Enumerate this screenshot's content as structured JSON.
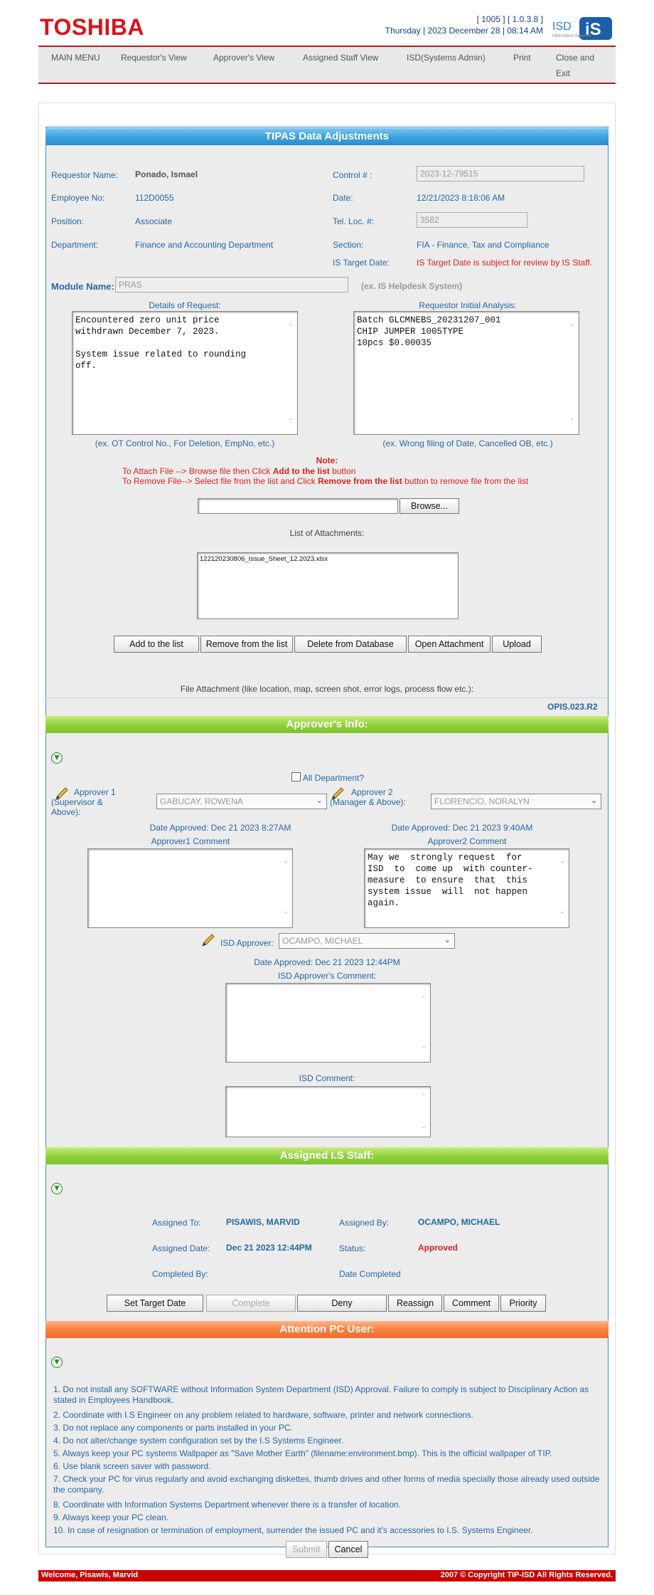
{
  "header": {
    "logo": "TOSHIBA",
    "version": "[ 1005 ] [ 1.0.3.8 ]",
    "datetime": "Thursday | 2023 December 28 | 08:14 AM",
    "isd_logo": "ISD"
  },
  "nav": [
    "MAIN MENU",
    "Requestor's View",
    "Approver's View",
    "Assigned Staff View",
    "ISD(Systems Admin)",
    "Print",
    "Close and",
    "Exit"
  ],
  "form": {
    "title": "TIPAS Data Adjustments",
    "requestor_name_label": "Requestor Name:",
    "requestor_name": "Ponado, Ismael",
    "control_label": "Control # :",
    "control_value": "2023-12-79515",
    "employee_no_label": "Employee No:",
    "employee_no": "112D0055",
    "date_label": "Date:",
    "date_value": "12/21/2023 8:18:06 AM",
    "position_label": "Position:",
    "position": "Associate",
    "telloc_label": "Tel. Loc. #:",
    "telloc_value": "3582",
    "department_label": "Department:",
    "department": "Finance and Accounting Department",
    "section_label": "Section:",
    "section": "FIA - Finance, Tax and Compliance",
    "target_date_label": "IS Target Date:",
    "target_date_note": "IS Target Date is subject for review by IS Staff.",
    "module_label": "Module Name:",
    "module_value": "PRAS",
    "module_hint": "(ex. IS Helpdesk System)",
    "details_label": "Details of Request:",
    "details_text": "Encountered zero unit price\nwithdrawn December 7, 2023.\n\nSystem issue related to rounding\noff.",
    "details_hint": "(ex. OT Control No., For Deletion, EmpNo, etc.)",
    "analysis_label": "Requestor Initial Analysis:",
    "analysis_text": "Batch GLCMNEBS_20231207_001\nCHIP JUMPER 1005TYPE\n10pcs $0.00035",
    "analysis_hint": "(ex. Wrong filing of Date, Cancelled OB, etc.)"
  },
  "attach": {
    "note_title": "Note:",
    "note1_a": "To Attach File --> Browse file then Click ",
    "note1_b": "Add to the list",
    "note1_c": "  button",
    "note2_a": "To Remove File--> Select file from the list and Click ",
    "note2_b": "Remove from the list",
    "note2_c": " button to remove file from the list",
    "browse_label": "Browse...",
    "list_label": "List of Attachments:",
    "file_item": "122120230806_Issue_Sheet_12.2023.xlsx",
    "buttons": [
      "Add to the list",
      "Remove from the list",
      "Delete from Database",
      "Open Attachment",
      "Upload"
    ],
    "file_caption": "File Attachment (like location, map, screen shot, error logs, process flow etc.):",
    "form_code": "OPIS.023.R2"
  },
  "approver": {
    "title": "Approver's Info:",
    "all_dept_label": "All Department?",
    "approver1_label": "Approver 1 (Supervisor & Above):",
    "approver1_value": "GABUCAY, ROWENA",
    "approver2_label": "Approver 2 (Manager & Above):",
    "approver2_value": "FLORENCIO, NORALYN",
    "approver1_date": "Date Approved: Dec 21 2023 8:27AM",
    "approver2_date": "Date Approved: Dec 21 2023 9:40AM",
    "approver1_comment_label": "Approver1 Comment",
    "approver1_comment": "",
    "approver2_comment_label": "Approver2 Comment",
    "approver2_comment": "May we  strongly request  for\nISD  to  come up  with counter-\nmeasure  to ensure  that  this\nsystem issue  will  not happen\nagain.",
    "isd_label": "ISD Approver:",
    "isd_value": "OCAMPO, MICHAEL",
    "isd_date": "Date Approved: Dec 21 2023 12:44PM",
    "isd_comment_label": "ISD Approver's Comment:",
    "isd_comment2_label": "ISD Comment:"
  },
  "staff": {
    "title": "Assigned I.S Staff:",
    "assigned_to_label": "Assigned To:",
    "assigned_to": "PISAWIS, MARVID",
    "assigned_by_label": "Assigned By:",
    "assigned_by": "OCAMPO, MICHAEL",
    "assigned_date_label": "Assigned Date:",
    "assigned_date": "Dec 21 2023 12:44PM",
    "status_label": "Status:",
    "status": "Approved",
    "completed_by_label": "Completed By:",
    "date_completed_label": "Date Completed",
    "buttons": [
      "Set Target Date",
      "Complete",
      "Deny",
      "Reassign",
      "Comment",
      "Priority"
    ]
  },
  "attention": {
    "title": "Attention PC User:",
    "rules": [
      "1. Do not install any SOFTWARE without Information System Department (ISD) Approval. Failure to comply is subject to Disciplinary Action as stated in Employees Handbook.",
      "2. Coordinate with I.S Engineer on any problem related to hardware, software, printer and network connections.",
      "3. Do not replace any components or parts installed in your PC.",
      "4. Do not alter/change system configuration set by the I.S Systems Engineer.",
      "5. Always keep your PC systems Wallpaper as \"Save Mother Earth\" (filename:environment.bmp). This is the official wallpaper of TIP.",
      "6. Use blank screen saver with password.",
      "7. Check your PC for virus regularly and avoid exchanging diskettes, thumb drives and other forms of media specially those already used outside the company.",
      "8. Coordinate with Information Systems Department whenever there is a transfer of location.",
      "9. Always keep your PC clean.",
      "10. In case of resignation or termination of employment, surrender the issued PC and it's accessories to I.S. Systems Engineer."
    ],
    "submit": "Submit",
    "cancel": "Cancel"
  },
  "footer": {
    "welcome": "Welcome, Pisawis, Marvid",
    "copyright": "2007 © Copyright TIP-ISD All Rights Reserved."
  },
  "colors": {
    "brand_red": "#d8141a",
    "label_blue": "#2567a5",
    "alert_red": "#e02020"
  }
}
